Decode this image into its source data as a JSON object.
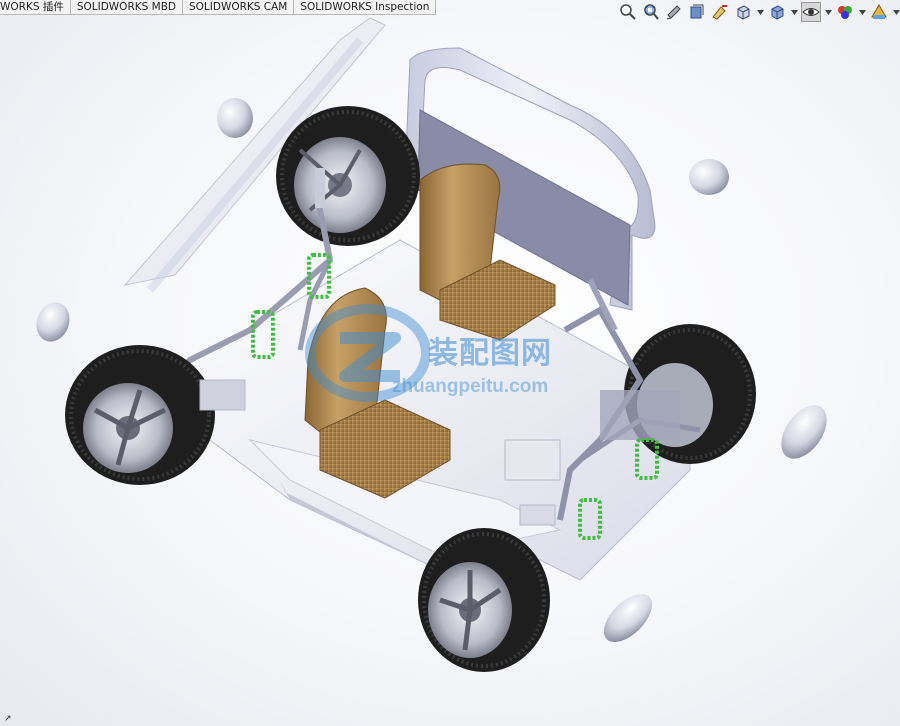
{
  "tabs": [
    {
      "label": "WORKS 插件"
    },
    {
      "label": "SOLIDWORKS MBD"
    },
    {
      "label": "SOLIDWORKS CAM"
    },
    {
      "label": "SOLIDWORKS Inspection"
    }
  ],
  "toolbar": {
    "icons": [
      "zoom-to-fit-icon",
      "zoom-to-area-icon",
      "previous-view-icon",
      "section-view-icon",
      "dynamic-annotation-icon",
      "view-orientation-icon",
      "display-style-icon",
      "hide-show-items-icon",
      "edit-appearance-icon",
      "apply-scene-icon"
    ]
  },
  "watermark": {
    "chinese": "装配图网",
    "url": "zhuangpeitu.com"
  },
  "corner_mark": "↗",
  "colors": {
    "accent": "#3c8cd2",
    "body_panel": "#e8eaf4",
    "seat": "#b8925a",
    "spring": "#3fbf3f",
    "tire": "#1e1e1e"
  }
}
